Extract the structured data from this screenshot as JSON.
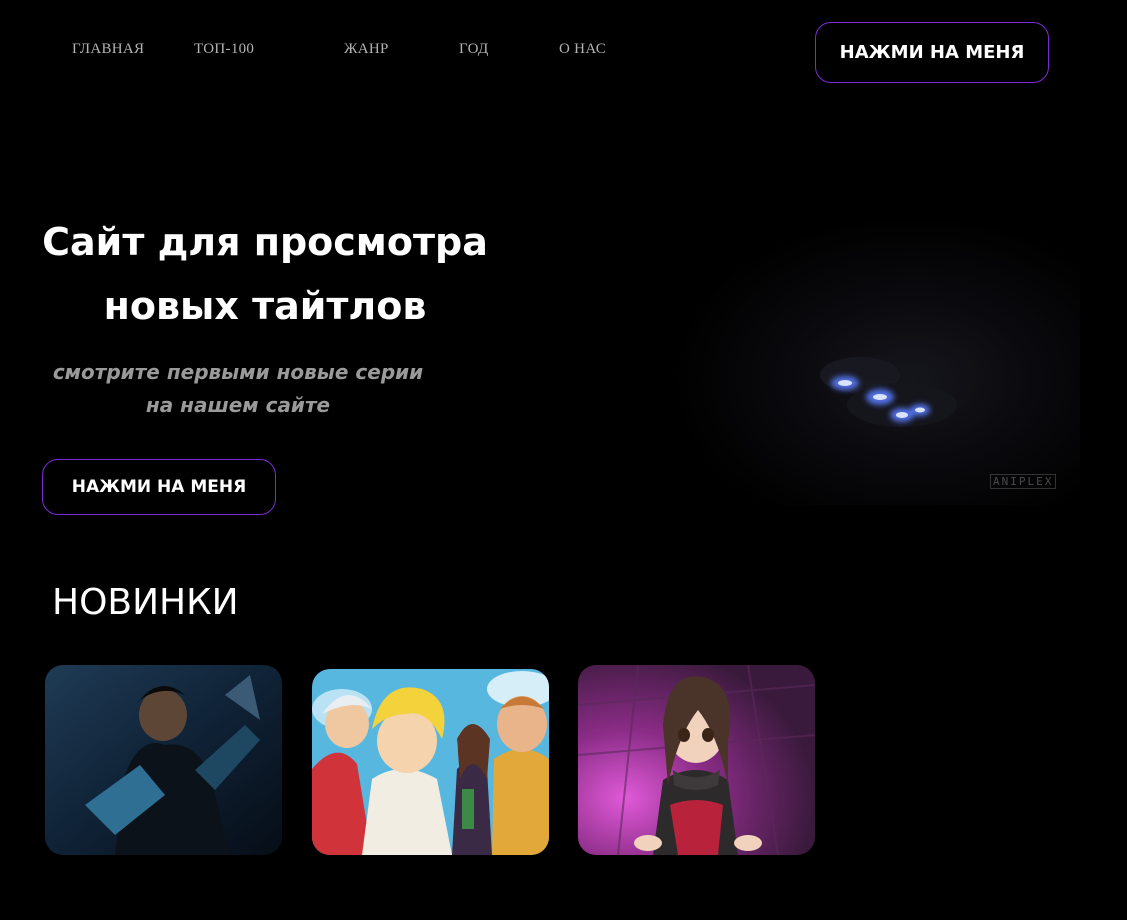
{
  "nav": {
    "items": [
      {
        "label": "ГЛАВНАЯ"
      },
      {
        "label": "ТОП-100"
      },
      {
        "label": "ЖАНР"
      },
      {
        "label": "ГОД"
      },
      {
        "label": "О НАС"
      }
    ],
    "cta_label": "НАЖМИ НА МЕНЯ"
  },
  "hero": {
    "title_line1": "Сайт для просмотра",
    "title_line2": "новых тайтлов",
    "subtitle_line1": "смотрите первыми новые серии",
    "subtitle_line2": "на нашем сайте",
    "cta_label": "НАЖМИ НА МЕНЯ",
    "watermark": "ANIPLEX"
  },
  "new_section": {
    "title": "НОВИНКИ",
    "cards": [
      {
        "icon": "dark-armored-warrior-artwork"
      },
      {
        "icon": "colorful-group-heroes-artwork"
      },
      {
        "icon": "girl-in-purple-hall-artwork"
      }
    ]
  },
  "colors": {
    "background": "#000000",
    "accent_border": "#7a2bd6",
    "nav_text": "#b3b3b3",
    "subtitle_text": "#9a9a9a"
  }
}
